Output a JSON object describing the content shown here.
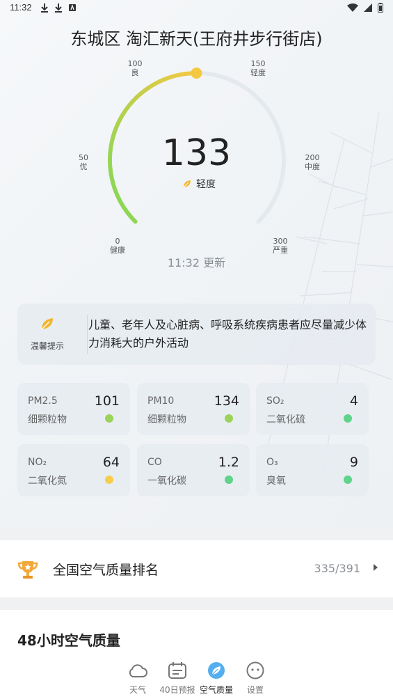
{
  "status_bar": {
    "time": "11:32"
  },
  "station": {
    "title": "东城区 淘汇新天(王府井步行街店)"
  },
  "gauge": {
    "aqi": "133",
    "level": "轻度",
    "update": "11:32 更新",
    "max": 300,
    "current": 133,
    "scale": [
      {
        "value": "0",
        "label": "健康"
      },
      {
        "value": "50",
        "label": "优"
      },
      {
        "value": "100",
        "label": "良"
      },
      {
        "value": "150",
        "label": "轻度"
      },
      {
        "value": "200",
        "label": "中度"
      },
      {
        "value": "300",
        "label": "严重"
      }
    ],
    "colors": {
      "start": "#7ed957",
      "end": "#f5c842",
      "track": "#e4e9ee"
    }
  },
  "tip": {
    "label": "温馨提示",
    "text": "儿童、老年人及心脏病、呼吸系统疾病患者应尽量减少体力消耗大的户外活动"
  },
  "pollutants": [
    {
      "name": "PM2.5",
      "sub": "细颗粒物",
      "value": "101",
      "color": "#9bd35a"
    },
    {
      "name": "PM10",
      "sub": "细颗粒物",
      "value": "134",
      "color": "#9bd35a"
    },
    {
      "name": "SO₂",
      "sub": "二氧化硫",
      "value": "4",
      "color": "#5fd38a"
    },
    {
      "name": "NO₂",
      "sub": "二氧化氮",
      "value": "64",
      "color": "#f7ce4a"
    },
    {
      "name": "CO",
      "sub": "一氧化碳",
      "value": "1.2",
      "color": "#5fd38a"
    },
    {
      "name": "O₃",
      "sub": "臭氧",
      "value": "9",
      "color": "#5fd38a"
    }
  ],
  "ranking": {
    "label": "全国空气质量排名",
    "value": "335/391"
  },
  "hourly": {
    "title": "48小时空气质量"
  },
  "nav": [
    {
      "label": "天气",
      "icon": "cloud-icon"
    },
    {
      "label": "40日预报",
      "icon": "calendar-icon"
    },
    {
      "label": "空气质量",
      "icon": "leaf-icon"
    },
    {
      "label": "设置",
      "icon": "face-icon"
    }
  ]
}
